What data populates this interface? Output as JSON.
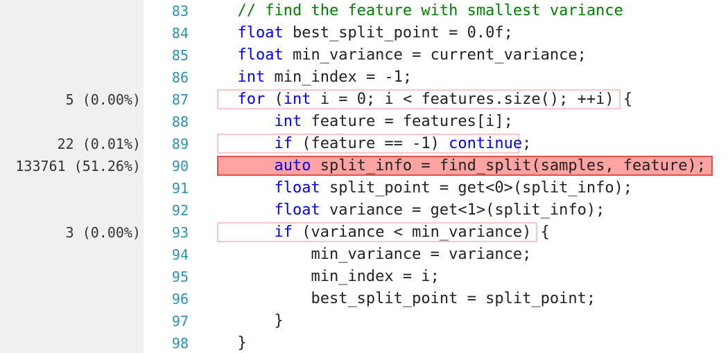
{
  "colors": {
    "gutter_background": "#f0f0f0",
    "line_number": "#2b91af",
    "keyword": "#0000ff",
    "comment": "#008000",
    "hot_line_fill": "#ffa3a3",
    "hot_line_border": "#e05050",
    "sampled_line_border": "#f6c8c8"
  },
  "lines": [
    {
      "number": "83",
      "samples": "",
      "heat": "none",
      "tokens": [
        {
          "t": "// find the feature with smallest variance",
          "c": "cm"
        }
      ]
    },
    {
      "number": "84",
      "samples": "",
      "heat": "none",
      "tokens": [
        {
          "t": "float",
          "c": "kw"
        },
        {
          "t": " best_split_point = 0.0f;",
          "c": "pl"
        }
      ]
    },
    {
      "number": "85",
      "samples": "",
      "heat": "none",
      "tokens": [
        {
          "t": "float",
          "c": "kw"
        },
        {
          "t": " min_variance = current_variance;",
          "c": "pl"
        }
      ]
    },
    {
      "number": "86",
      "samples": "",
      "heat": "none",
      "tokens": [
        {
          "t": "int",
          "c": "kw"
        },
        {
          "t": " min_index = -1;",
          "c": "pl"
        }
      ]
    },
    {
      "number": "87",
      "samples": "5 (0.00%)",
      "heat": "light",
      "tokens": [
        {
          "t": "for",
          "c": "kw"
        },
        {
          "t": " (",
          "c": "pl"
        },
        {
          "t": "int",
          "c": "kw"
        },
        {
          "t": " i = 0; i < features.size(); ++i) {",
          "c": "pl"
        }
      ]
    },
    {
      "number": "88",
      "samples": "",
      "heat": "none",
      "tokens": [
        {
          "t": "    ",
          "c": "pl"
        },
        {
          "t": "int",
          "c": "kw"
        },
        {
          "t": " feature = features[i];",
          "c": "pl"
        }
      ]
    },
    {
      "number": "89",
      "samples": "22 (0.01%)",
      "heat": "light",
      "tokens": [
        {
          "t": "    ",
          "c": "pl"
        },
        {
          "t": "if",
          "c": "kw"
        },
        {
          "t": " (feature == -1) ",
          "c": "pl"
        },
        {
          "t": "continue",
          "c": "kw"
        },
        {
          "t": ";",
          "c": "pl"
        }
      ]
    },
    {
      "number": "90",
      "samples": "133761 (51.26%)",
      "heat": "hot",
      "tokens": [
        {
          "t": "    ",
          "c": "pl"
        },
        {
          "t": "auto",
          "c": "kw"
        },
        {
          "t": " split_info = find_split(samples, feature);",
          "c": "pl"
        }
      ]
    },
    {
      "number": "91",
      "samples": "",
      "heat": "none",
      "tokens": [
        {
          "t": "    ",
          "c": "pl"
        },
        {
          "t": "float",
          "c": "kw"
        },
        {
          "t": " split_point = get<0>(split_info);",
          "c": "pl"
        }
      ]
    },
    {
      "number": "92",
      "samples": "",
      "heat": "none",
      "tokens": [
        {
          "t": "    ",
          "c": "pl"
        },
        {
          "t": "float",
          "c": "kw"
        },
        {
          "t": " variance = get<1>(split_info);",
          "c": "pl"
        }
      ]
    },
    {
      "number": "93",
      "samples": "3 (0.00%)",
      "heat": "light",
      "tokens": [
        {
          "t": "    ",
          "c": "pl"
        },
        {
          "t": "if",
          "c": "kw"
        },
        {
          "t": " (variance < min_variance) {",
          "c": "pl"
        }
      ]
    },
    {
      "number": "94",
      "samples": "",
      "heat": "none",
      "tokens": [
        {
          "t": "        min_variance = variance;",
          "c": "pl"
        }
      ]
    },
    {
      "number": "95",
      "samples": "",
      "heat": "none",
      "tokens": [
        {
          "t": "        min_index = i;",
          "c": "pl"
        }
      ]
    },
    {
      "number": "96",
      "samples": "",
      "heat": "none",
      "tokens": [
        {
          "t": "        best_split_point = split_point;",
          "c": "pl"
        }
      ]
    },
    {
      "number": "97",
      "samples": "",
      "heat": "none",
      "tokens": [
        {
          "t": "    }",
          "c": "pl"
        }
      ]
    },
    {
      "number": "98",
      "samples": "",
      "heat": "none",
      "tokens": [
        {
          "t": "}",
          "c": "pl"
        }
      ]
    }
  ]
}
